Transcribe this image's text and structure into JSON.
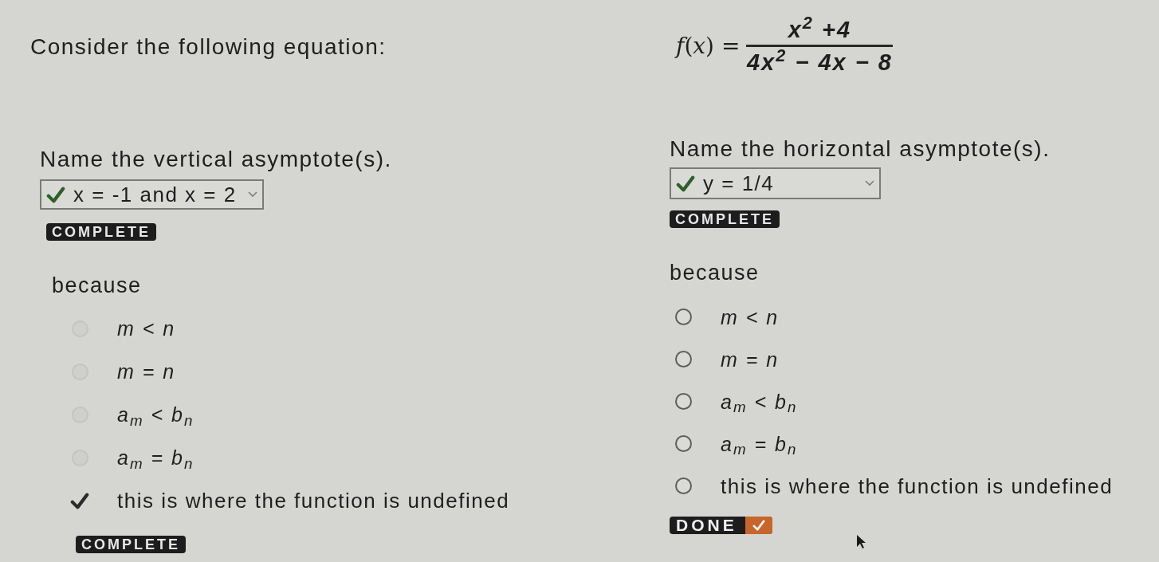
{
  "prompt": {
    "text": "Consider the following equation:",
    "lhs": "*f*(*x*) =",
    "numerator": "x$^{2}$ +4",
    "denominator": "4x$^{2}$ − 4x − 8"
  },
  "questions": [
    {
      "label": "Name the vertical asymptote(s).",
      "answer": {
        "value": "x = -1 and x = 2",
        "correct": true
      },
      "status": {
        "kind": "badge",
        "text": "COMPLETE"
      },
      "because": "because",
      "disabled": true,
      "options": [
        {
          "kind": "math",
          "text": "m < n",
          "selected": false
        },
        {
          "kind": "math",
          "text": "m = n",
          "selected": false
        },
        {
          "kind": "math",
          "text": "a$_{m}$ < b$_{n}$",
          "selected": false
        },
        {
          "kind": "math",
          "text": "a$_{m}$ = b$_{n}$",
          "selected": false
        },
        {
          "kind": "text",
          "text": "this is where the function is undefined",
          "selected": true
        }
      ],
      "footer": {
        "kind": "badge",
        "text": "COMPLETE"
      }
    },
    {
      "label": "Name the horizontal asymptote(s).",
      "answer": {
        "value": "y = 1/4",
        "correct": true
      },
      "status": {
        "kind": "badge",
        "text": "COMPLETE"
      },
      "because": "because",
      "disabled": false,
      "options": [
        {
          "kind": "math",
          "text": "m < n",
          "selected": false
        },
        {
          "kind": "math",
          "text": "m = n",
          "selected": false
        },
        {
          "kind": "math",
          "text": "a$_{m}$ < b$_{n}$",
          "selected": false
        },
        {
          "kind": "math",
          "text": "a$_{m}$ = b$_{n}$",
          "selected": false
        },
        {
          "kind": "text",
          "text": "this is where the function is undefined",
          "selected": false
        }
      ],
      "footer": {
        "kind": "done_button",
        "text": "DONE"
      }
    }
  ]
}
